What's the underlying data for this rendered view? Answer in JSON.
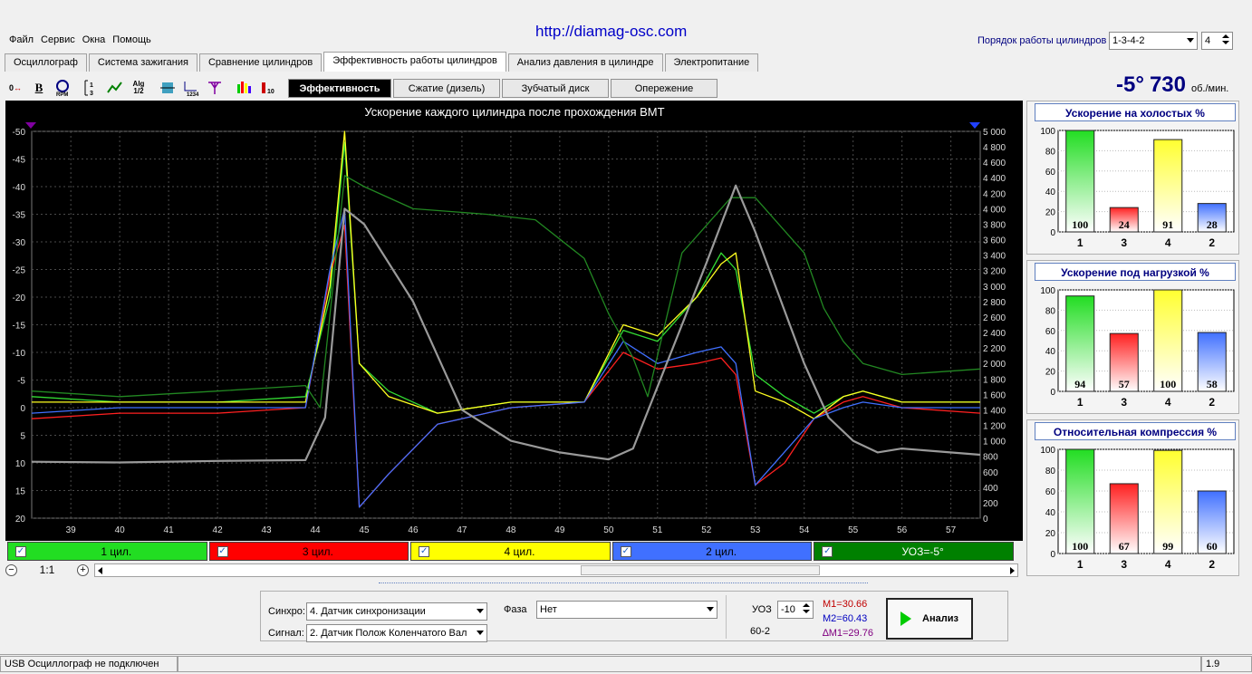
{
  "url": "http://diamag-osc.com",
  "menu": [
    "Файл",
    "Сервис",
    "Окна",
    "Помощь"
  ],
  "cylinder_order": {
    "label": "Порядок работы цилиндров",
    "value": "1-3-4-2",
    "count": "4"
  },
  "tabs": [
    "Осциллограф",
    "Система зажигания",
    "Сравнение цилиндров",
    "Эффективность работы цилиндров",
    "Анализ давления в цилиндре",
    "Электропитание"
  ],
  "active_tab": 3,
  "toolbar_icons": [
    "phase-shift-icon",
    "bold-icon",
    "rpm-icon",
    "numbering-icon",
    "graph-icon",
    "algorithm-icon",
    "filter-icon",
    "number-axis-icon",
    "marker-icon",
    "chart-bars-icon",
    "cylinder-icon"
  ],
  "subtabs": [
    "Эффективность",
    "Сжатие (дизель)",
    "Зубчатый диск",
    "Опережение"
  ],
  "active_subtab": 0,
  "ignition": {
    "angle": "-5°",
    "rpm": "730",
    "unit": "об./мин."
  },
  "chart_data": {
    "type": "line",
    "title": "Ускорение каждого цилиндра после прохождения ВМТ",
    "x_ticks": [
      "39",
      "40",
      "41",
      "42",
      "43",
      "44",
      "45",
      "46",
      "47",
      "48",
      "49",
      "50",
      "51",
      "52",
      "53",
      "54",
      "55",
      "56",
      "57"
    ],
    "xlim": [
      38.2,
      57.6
    ],
    "y_left_ticks": [
      "-50",
      "-45",
      "-40",
      "-35",
      "-30",
      "-25",
      "-20",
      "-15",
      "-10",
      "-5",
      "0",
      "5",
      "10",
      "15",
      "20"
    ],
    "ylim_left": [
      -50,
      20
    ],
    "y_right_ticks": [
      "5 000",
      "4 800",
      "4 600",
      "4 400",
      "4 200",
      "4 000",
      "3 800",
      "3 600",
      "3 400",
      "3 200",
      "3 000",
      "2 800",
      "2 600",
      "2 400",
      "2 200",
      "2 000",
      "1 800",
      "1 600",
      "1 400",
      "1 200",
      "1 000",
      "800",
      "600",
      "400",
      "200",
      "0"
    ],
    "ylim_right": [
      0,
      5000
    ],
    "series": [
      {
        "name": "1 цил.",
        "color": "#33dd33",
        "x": [
          38.2,
          40,
          42,
          43.8,
          44.3,
          44.6,
          44.9,
          45.5,
          46.5,
          48,
          49.5,
          50.3,
          51,
          51.8,
          52.3,
          52.6,
          53,
          53.6,
          54.2,
          54.8,
          55.2,
          56,
          57.6
        ],
        "y": [
          -2,
          -1,
          -1,
          -2,
          -20,
          -48,
          -8,
          -3,
          1,
          -1,
          -1,
          -14,
          -12,
          -20,
          -28,
          -25,
          -6,
          -2,
          1,
          -2,
          -3,
          -1,
          -1
        ]
      },
      {
        "name": "3 цил.",
        "color": "#ff2020",
        "x": [
          38.2,
          40,
          42,
          43.8,
          44.3,
          44.6,
          44.9,
          45.5,
          46.5,
          48,
          49.5,
          50.3,
          51,
          51.8,
          52.3,
          52.6,
          53,
          53.6,
          54.2,
          54.8,
          55.2,
          56,
          57.6
        ],
        "y": [
          2,
          1,
          1,
          0,
          -24,
          -33,
          18,
          12,
          3,
          0,
          -1,
          -10,
          -7,
          -8,
          -9,
          -6,
          14,
          10,
          2,
          -1,
          -2,
          0,
          1
        ]
      },
      {
        "name": "4 цил.",
        "color": "#ffff20",
        "x": [
          38.2,
          40,
          42,
          43.8,
          44.3,
          44.6,
          44.9,
          45.5,
          46.5,
          48,
          49.5,
          50.3,
          51,
          51.8,
          52.3,
          52.6,
          53,
          53.6,
          54.2,
          54.8,
          55.2,
          56,
          57.6
        ],
        "y": [
          -1,
          -1,
          -1,
          -1,
          -22,
          -50,
          -8,
          -2,
          1,
          -1,
          -1,
          -15,
          -13,
          -20,
          -26,
          -28,
          -3,
          -1,
          2,
          -2,
          -3,
          -1,
          -1
        ]
      },
      {
        "name": "2 цил.",
        "color": "#4070ff",
        "x": [
          38.2,
          40,
          42,
          43.8,
          44.3,
          44.6,
          44.9,
          45.5,
          46.5,
          48,
          49.5,
          50.3,
          51,
          51.8,
          52.3,
          52.6,
          53,
          53.6,
          54.2,
          54.8,
          55.2,
          56,
          57.6
        ],
        "y": [
          1,
          0,
          0,
          0,
          -25,
          -36,
          18,
          12,
          3,
          0,
          -1,
          -12,
          -8,
          -10,
          -11,
          -8,
          14,
          8,
          2,
          0,
          -1,
          0,
          0
        ]
      },
      {
        "name": "УОЗ=-5°",
        "color": "#228822",
        "x": [
          38.2,
          40,
          42,
          43.8,
          44.1,
          44.6,
          45,
          46,
          47.5,
          48.5,
          49.5,
          50,
          50.5,
          50.8,
          51.5,
          52.5,
          53,
          53.6,
          54,
          54.4,
          54.8,
          55.2,
          56,
          57.6
        ],
        "y": [
          -3,
          -2,
          -3,
          -4,
          0,
          -42,
          -40,
          -36,
          -35,
          -34,
          -27,
          -17,
          -9,
          -2,
          -28,
          -38,
          -38,
          -32,
          -28,
          -18,
          -12,
          -8,
          -6,
          -7
        ]
      },
      {
        "name": "rpm",
        "color": "#9a9a9a",
        "axis": "right",
        "x": [
          38.2,
          40,
          42,
          43.8,
          44.2,
          44.6,
          45,
          46,
          47,
          48,
          49,
          50,
          50.5,
          51,
          52,
          52.6,
          53,
          54,
          54.5,
          55,
          55.5,
          56,
          57.6
        ],
        "y": [
          730,
          720,
          740,
          750,
          1300,
          4000,
          3800,
          2800,
          1400,
          1000,
          850,
          760,
          900,
          1700,
          3300,
          4300,
          3700,
          2000,
          1300,
          1000,
          850,
          900,
          820
        ]
      }
    ]
  },
  "legend": [
    {
      "label": "1 цил.",
      "color": "#22dd22"
    },
    {
      "label": "3 цил.",
      "color": "#ff0000"
    },
    {
      "label": "4 цил.",
      "color": "#ffff00"
    },
    {
      "label": "2 цил.",
      "color": "#4070ff"
    },
    {
      "label": "УОЗ=-5°",
      "color": "#008000"
    }
  ],
  "zoom": "1:1",
  "bar_panels": [
    {
      "title": "Ускорение на холостых %",
      "cylinders": [
        "1",
        "3",
        "4",
        "2"
      ],
      "values": [
        100,
        24,
        91,
        28
      ]
    },
    {
      "title": "Ускорение под нагрузкой %",
      "cylinders": [
        "1",
        "3",
        "4",
        "2"
      ],
      "values": [
        94,
        57,
        100,
        58
      ]
    },
    {
      "title": "Относительная компрессия %",
      "cylinders": [
        "1",
        "3",
        "4",
        "2"
      ],
      "values": [
        100,
        67,
        99,
        60
      ]
    }
  ],
  "bar_axis_ticks": [
    "100",
    "80",
    "60",
    "40",
    "20",
    "0"
  ],
  "bar_colors": [
    "#22dd22",
    "#ff2020",
    "#ffff30",
    "#4070ff"
  ],
  "controls": {
    "sync_label": "Синхро:",
    "sync_value": "4.  Датчик синхронизации",
    "signal_label": "Сигнал:",
    "signal_value": "2.  Датчик Полож Коленчатого Вал",
    "phase_label": "Фаза",
    "phase_value": "Нет",
    "uoz_label": "УОЗ",
    "uoz_value": "-10",
    "teeth": "60-2",
    "m1": "M1=30.66",
    "m2": "M2=60.43",
    "dm": "∆M1=29.76",
    "analyze": "Анализ"
  },
  "status": {
    "left": "USB Осциллограф не подключен",
    "right": "1.9"
  }
}
